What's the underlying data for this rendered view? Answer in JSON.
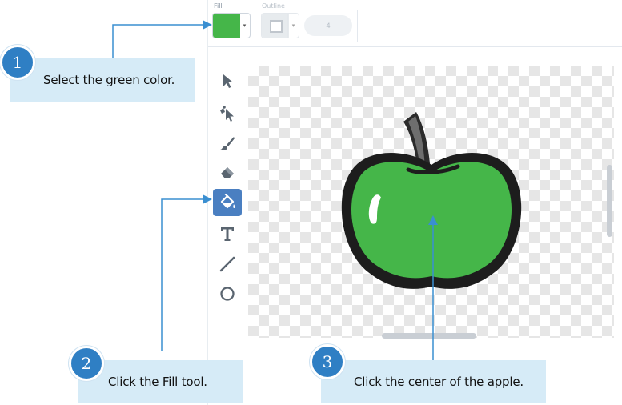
{
  "colors": {
    "fill_green": "#45b649",
    "accent_blue": "#4a7fc1",
    "callout_bg": "#d6ebf7",
    "badge_blue": "#2f7fc4",
    "connector_blue": "#3a8fd1"
  },
  "toolbar": {
    "fill_label": "Fill",
    "fill_color": "#45b649",
    "fill_caret_icon": "chevron-down-icon",
    "outline_label": "Outline",
    "outline_width_value": "4"
  },
  "tools": [
    {
      "name": "select",
      "icon": "arrow-pointer-icon",
      "selected": false
    },
    {
      "name": "reshape",
      "icon": "reshape-pointer-icon",
      "selected": false
    },
    {
      "name": "brush",
      "icon": "brush-icon",
      "selected": false
    },
    {
      "name": "eraser",
      "icon": "eraser-icon",
      "selected": false
    },
    {
      "name": "fill",
      "icon": "paint-bucket-icon",
      "selected": true
    },
    {
      "name": "text",
      "icon": "text-t-icon",
      "selected": false
    },
    {
      "name": "line",
      "icon": "line-icon",
      "selected": false
    },
    {
      "name": "circle",
      "icon": "circle-icon",
      "selected": false
    }
  ],
  "canvas": {
    "content": "green apple drawing",
    "background": "transparent checkerboard"
  },
  "steps": [
    {
      "number": "1",
      "text": "Select the green color."
    },
    {
      "number": "2",
      "text": "Click the Fill tool."
    },
    {
      "number": "3",
      "text": "Click the center of the apple."
    }
  ]
}
